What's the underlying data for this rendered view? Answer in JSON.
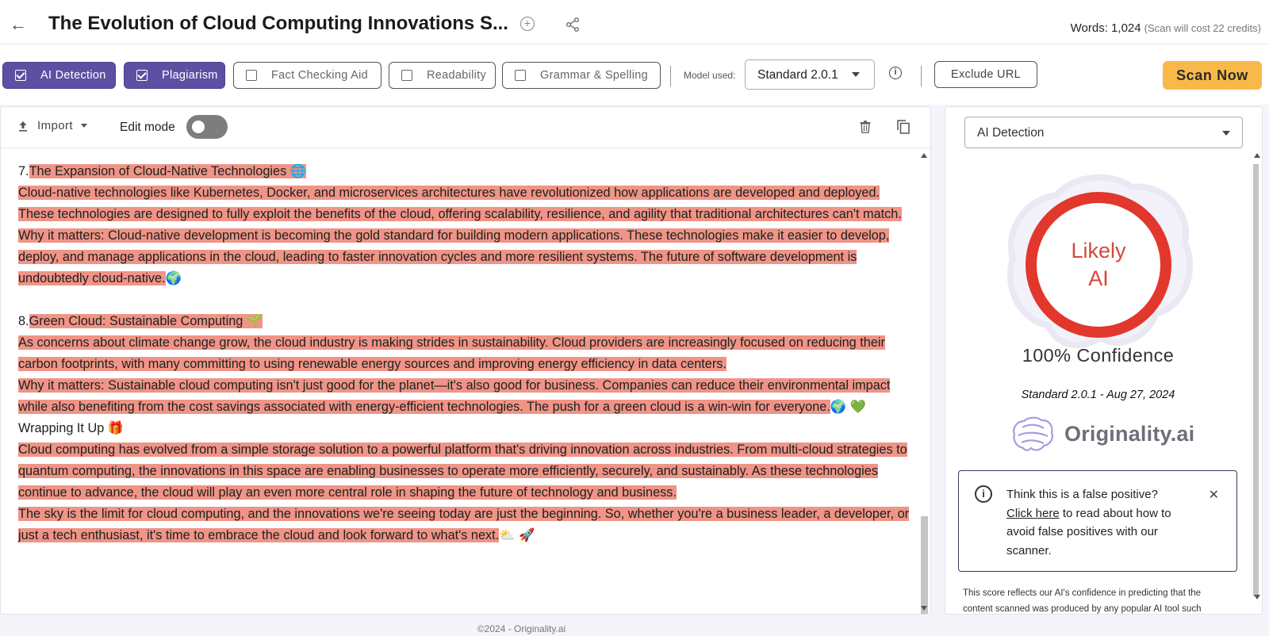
{
  "header": {
    "title": "The Evolution of Cloud Computing Innovations S...",
    "words_label": "Words: 1,024",
    "cost_note": "(Scan will cost 22 credits)"
  },
  "toolbar": {
    "chips": [
      {
        "label": "AI Detection",
        "checked": true
      },
      {
        "label": "Plagiarism",
        "checked": true
      },
      {
        "label": "Fact Checking Aid",
        "checked": false
      },
      {
        "label": "Readability",
        "checked": false
      },
      {
        "label": "Grammar & Spelling",
        "checked": false
      }
    ],
    "model_label": "Model used:",
    "model_value": "Standard 2.0.1",
    "exclude_label": "Exclude URL",
    "scan_label": "Scan Now"
  },
  "editor": {
    "import_label": "Import",
    "edit_mode_label": "Edit mode",
    "edit_mode_on": false,
    "sections": [
      {
        "num": "7.",
        "heading": "The Expansion of Cloud-Native Technologies 🌐",
        "paragraphs": [
          "Cloud-native technologies like Kubernetes, Docker, and microservices architectures have revolutionized how applications are developed and deployed. These technologies are designed to fully exploit the benefits of the cloud, offering scalability, resilience, and agility that traditional architectures can't match.",
          "Why it matters: Cloud-native development is becoming the gold standard for building modern applications. These technologies make it easier to develop, deploy, and manage applications in the cloud, leading to faster innovation cycles and more resilient systems. The future of software development is undoubtedly cloud-native."
        ],
        "trailing_emoji": "🌍"
      },
      {
        "num": "8.",
        "heading": "Green Cloud: Sustainable Computing 🌱",
        "paragraphs": [
          "As concerns about climate change grow, the cloud industry is making strides in sustainability. Cloud providers are increasingly focused on reducing their carbon footprints, with many committing to using renewable energy sources and improving energy efficiency in data centers.",
          "Why it matters: Sustainable cloud computing isn't just good for the planet—it's also good for business. Companies can reduce their environmental impact while also benefiting from the cost savings associated with energy-efficient technologies. The push for a green cloud is a win-win for everyone."
        ],
        "trailing_emoji": "🌍 💚"
      }
    ],
    "wrap_heading": "Wrapping It Up 🎁",
    "wrap_paragraphs": [
      "Cloud computing has evolved from a simple storage solution to a powerful platform that's driving innovation across industries. From multi-cloud strategies to quantum computing, the innovations in this space are enabling businesses to operate more efficiently, securely, and sustainably. As these technologies continue to advance, the cloud will play an even more central role in shaping the future of technology and business.",
      "The sky is the limit for cloud computing, and the innovations we're seeing today are just the beginning. So, whether you're a business leader, a developer, or just a tech enthusiast, it's time to embrace the cloud and look forward to what's next."
    ],
    "wrap_trailing_emoji": "⛅ 🚀"
  },
  "results": {
    "select_value": "AI Detection",
    "verdict_line1": "Likely",
    "verdict_line2": "AI",
    "confidence": "100% Confidence",
    "model_date": "Standard 2.0.1 - Aug 27, 2024",
    "brand": "Originality.ai",
    "fp_question": "Think this is a false positive?",
    "fp_link": "Click here",
    "fp_rest": " to read about how to avoid false positives with our scanner.",
    "explain": "This score reflects our AI's confidence in predicting that the content scanned was produced by any popular AI tool such"
  },
  "footer": {
    "copyright": "©2024 - Originality.ai"
  },
  "colors": {
    "accent": "#5f4fa3",
    "scan": "#f9b94a",
    "highlight": "#ef9486",
    "verdict_red": "#e2372c"
  }
}
